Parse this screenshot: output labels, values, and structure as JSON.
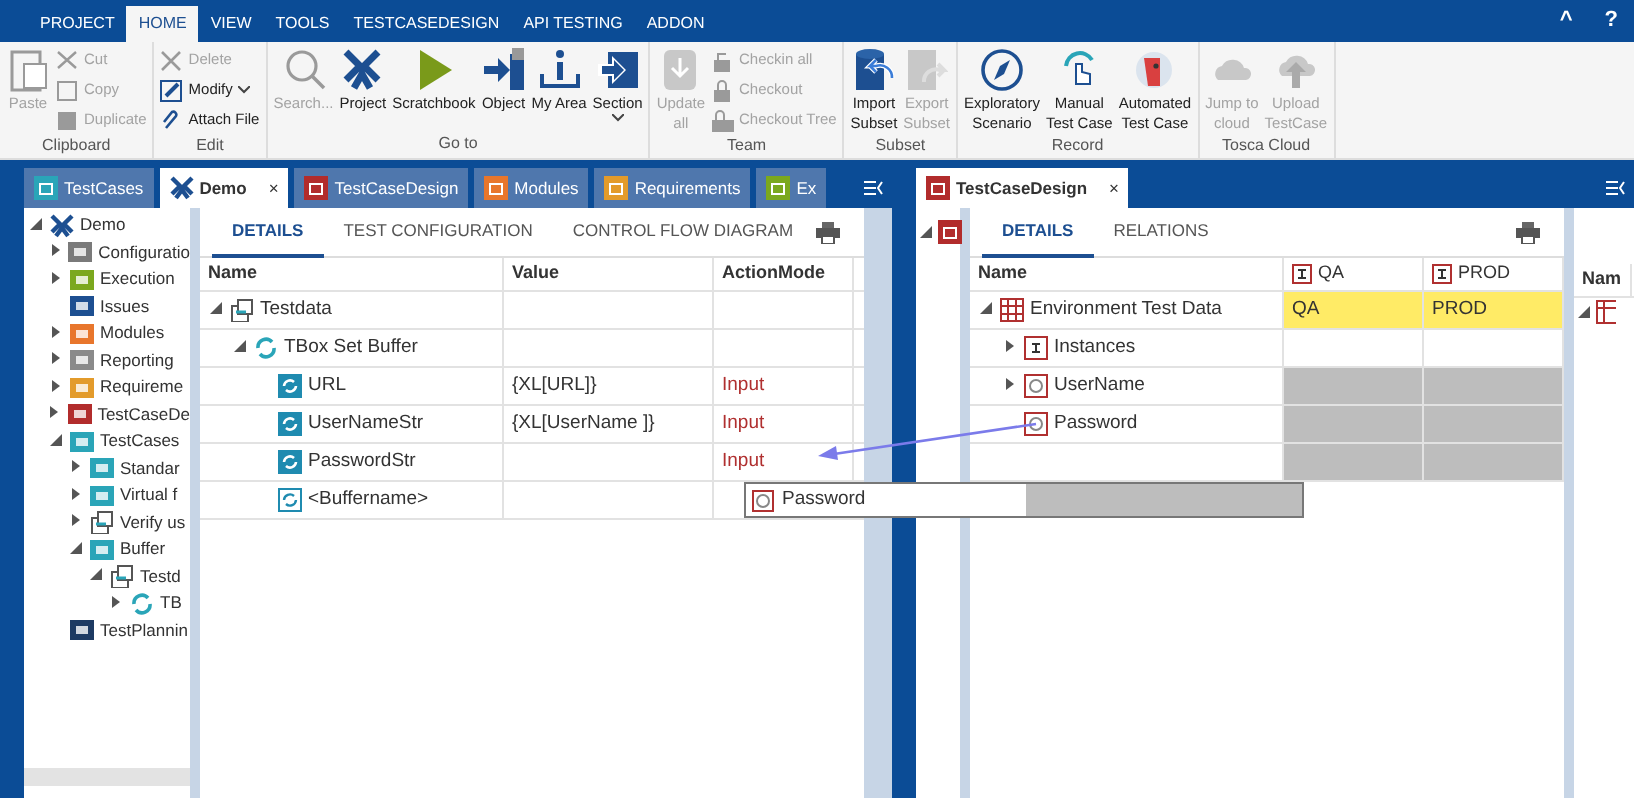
{
  "menu_tabs": [
    {
      "label": "PROJECT",
      "selected": false
    },
    {
      "label": "HOME",
      "selected": true
    },
    {
      "label": "VIEW",
      "selected": false
    },
    {
      "label": "TOOLS",
      "selected": false
    },
    {
      "label": "TESTCASEDESIGN",
      "selected": false
    },
    {
      "label": "API TESTING",
      "selected": false
    },
    {
      "label": "ADDON",
      "selected": false
    }
  ],
  "window_controls": {
    "collapse": "^",
    "help": "?"
  },
  "ribbon_groups": [
    {
      "label": "Clipboard",
      "items": [
        {
          "label": "Paste",
          "kind": "large",
          "disabled": true
        },
        {
          "label": "Cut",
          "kind": "small",
          "disabled": true
        },
        {
          "label": "Copy",
          "kind": "small",
          "disabled": true
        },
        {
          "label": "Duplicate",
          "kind": "small",
          "disabled": true
        }
      ]
    },
    {
      "label": "Edit",
      "items": [
        {
          "label": "Delete",
          "kind": "small",
          "disabled": true
        },
        {
          "label": "Modify",
          "kind": "small",
          "disabled": false,
          "dropdown": true
        },
        {
          "label": "Attach File",
          "kind": "small",
          "disabled": false
        }
      ]
    },
    {
      "label": "Go to",
      "items": [
        {
          "label": "Search...",
          "kind": "large",
          "disabled": true
        },
        {
          "label": "Project",
          "kind": "large",
          "disabled": false
        },
        {
          "label": "Scratchbook",
          "kind": "large",
          "disabled": false
        },
        {
          "label": "Object",
          "kind": "large",
          "disabled": false
        },
        {
          "label": "My Area",
          "kind": "large",
          "disabled": false
        },
        {
          "label": "Section",
          "kind": "large",
          "disabled": false,
          "dropdown": true
        }
      ]
    },
    {
      "label": "Team",
      "items": [
        {
          "label": "Update\nall",
          "kind": "large",
          "disabled": true
        },
        {
          "label": "Checkin all",
          "kind": "small",
          "disabled": true
        },
        {
          "label": "Checkout",
          "kind": "small",
          "disabled": true
        },
        {
          "label": "Checkout Tree",
          "kind": "small",
          "disabled": true
        }
      ]
    },
    {
      "label": "Subset",
      "items": [
        {
          "label": "Import\nSubset",
          "kind": "large",
          "disabled": false
        },
        {
          "label": "Export\nSubset",
          "kind": "large",
          "disabled": true
        }
      ]
    },
    {
      "label": "Record",
      "items": [
        {
          "label": "Exploratory\nScenario",
          "kind": "large",
          "disabled": false
        },
        {
          "label": "Manual\nTest Case",
          "kind": "large",
          "disabled": false
        },
        {
          "label": "Automated\nTest Case",
          "kind": "large",
          "disabled": false
        }
      ]
    },
    {
      "label": "Tosca Cloud",
      "items": [
        {
          "label": "Jump to\ncloud",
          "kind": "large",
          "disabled": true
        },
        {
          "label": "Upload\nTestCase",
          "kind": "large",
          "disabled": true
        }
      ]
    }
  ],
  "left_pane": {
    "doc_tabs": [
      {
        "label": "TestCases",
        "kind": "folder",
        "color": "#2aa5b8",
        "selected": false
      },
      {
        "label": "Demo",
        "kind": "project",
        "selected": true,
        "close": "×"
      },
      {
        "label": "TestCaseDesign",
        "kind": "folder",
        "color": "#b22c2c",
        "selected": false
      },
      {
        "label": "Modules",
        "kind": "folder",
        "color": "#e8762c",
        "selected": false
      },
      {
        "label": "Requirements",
        "kind": "folder",
        "color": "#e39b2b",
        "selected": false
      },
      {
        "label": "Ex",
        "kind": "folder",
        "color": "#7ba81e",
        "selected": false
      }
    ],
    "tree": [
      {
        "label": "Demo",
        "kind": "project",
        "expanded": true,
        "children": [
          {
            "label": "Configuratio",
            "kind": "folder",
            "color": "#7a7a7a",
            "expanded": false
          },
          {
            "label": "Execution",
            "kind": "folder",
            "color": "#7ba81e",
            "expanded": false
          },
          {
            "label": "Issues",
            "kind": "folder",
            "color": "#1d4f91"
          },
          {
            "label": "Modules",
            "kind": "folder",
            "color": "#e8762c",
            "expanded": false
          },
          {
            "label": "Reporting",
            "kind": "folder",
            "color": "#8a8a8a",
            "expanded": false
          },
          {
            "label": "Requireme",
            "kind": "folder",
            "color": "#e39b2b",
            "expanded": false
          },
          {
            "label": "TestCaseDe",
            "kind": "folder",
            "color": "#b22c2c",
            "expanded": false
          },
          {
            "label": "TestCases",
            "kind": "folder",
            "color": "#2aa5b8",
            "expanded": true,
            "children": [
              {
                "label": "Standar",
                "kind": "folder",
                "color": "#2aa5b8",
                "expanded": false
              },
              {
                "label": "Virtual f",
                "kind": "folder",
                "color": "#2aa5b8",
                "expanded": false
              },
              {
                "label": "Verify us",
                "kind": "template",
                "expanded": false
              },
              {
                "label": "Buffer",
                "kind": "folder",
                "color": "#2aa5b8",
                "expanded": true,
                "children": [
                  {
                    "label": "Testd",
                    "kind": "template",
                    "expanded": true,
                    "children": [
                      {
                        "label": "TB",
                        "kind": "step",
                        "expanded": false
                      }
                    ]
                  }
                ]
              }
            ]
          },
          {
            "label": "TestPlannin",
            "kind": "folder",
            "color": "#1d3a63"
          }
        ]
      }
    ],
    "detail_tabs": [
      {
        "label": "DETAILS",
        "selected": true
      },
      {
        "label": "TEST CONFIGURATION",
        "selected": false
      },
      {
        "label": "CONTROL FLOW DIAGRAM",
        "selected": false
      }
    ],
    "table": {
      "columns": [
        "Name",
        "Value",
        "ActionMode"
      ],
      "rows": [
        {
          "name": "Testdata",
          "kind": "template",
          "expanded": true,
          "children": [
            {
              "name": "TBox Set Buffer",
              "kind": "step",
              "expanded": true,
              "children": [
                {
                  "name": "URL",
                  "kind": "value",
                  "value": "{XL[URL]}",
                  "action_mode": "Input"
                },
                {
                  "name": "UserNameStr",
                  "kind": "value",
                  "value": "{XL[UserName ]}",
                  "action_mode": "Input"
                },
                {
                  "name": "PasswordStr",
                  "kind": "value",
                  "action_mode": "Input"
                },
                {
                  "name": "<Buffername>",
                  "kind": "placeholder"
                }
              ]
            }
          ]
        }
      ]
    }
  },
  "right_pane": {
    "doc_tabs": [
      {
        "label": "TestCaseDesign",
        "kind": "folder",
        "color": "#b22c2c",
        "selected": true,
        "close": "×"
      }
    ],
    "detail_tabs": [
      {
        "label": "DETAILS",
        "selected": true
      },
      {
        "label": "RELATIONS",
        "selected": false
      }
    ],
    "table": {
      "columns": [
        "Name",
        "QA",
        "PROD"
      ],
      "rows": [
        {
          "name": "Environment Test Data",
          "kind": "table",
          "expanded": true,
          "highlighted": true,
          "inactive": false,
          "qa": "QA",
          "prod": "PROD"
        },
        {
          "name": "Instances",
          "kind": "instances",
          "expanded": false,
          "highlighted": false,
          "inactive": false
        },
        {
          "name": "UserName",
          "kind": "attribute",
          "expanded": false,
          "highlighted": false,
          "inactive": true
        },
        {
          "name": "Password",
          "kind": "attribute",
          "highlighted": false,
          "inactive": true
        },
        {
          "highlighted": false,
          "inactive": true
        }
      ]
    },
    "side_column": "Nam"
  },
  "drag_preview": {
    "label": "Password"
  }
}
